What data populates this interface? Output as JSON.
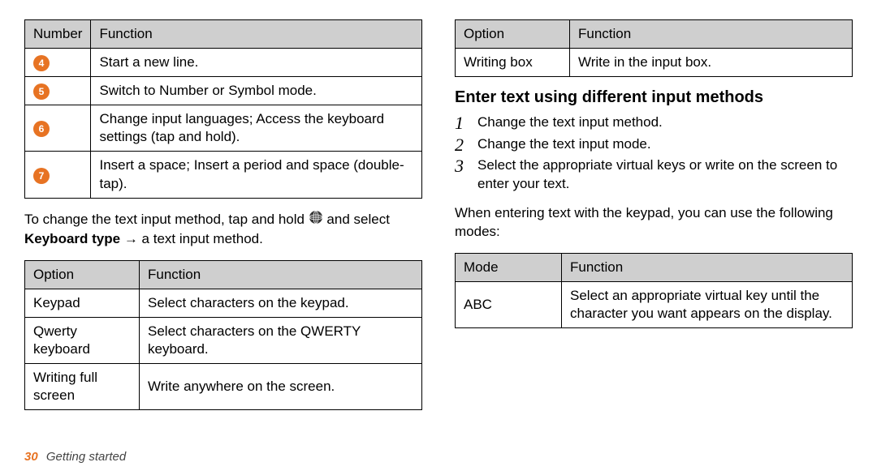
{
  "table1": {
    "headers": [
      "Number",
      "Function"
    ],
    "rows": [
      {
        "n": "4",
        "fn": "Start a new line."
      },
      {
        "n": "5",
        "fn": "Switch to Number or Symbol mode."
      },
      {
        "n": "6",
        "fn": "Change input languages; Access the keyboard settings (tap and hold)."
      },
      {
        "n": "7",
        "fn": "Insert a space; Insert a period and space (double-tap)."
      }
    ]
  },
  "para1_a": "To change the text input method, tap and hold ",
  "para1_b": " and select ",
  "para1_bold": "Keyboard type",
  "para1_c": " → a text input method.",
  "table2": {
    "headers": [
      "Option",
      "Function"
    ],
    "rows": [
      {
        "opt": "Keypad",
        "fn": "Select characters on the keypad."
      },
      {
        "opt": "Qwerty keyboard",
        "fn": "Select characters on the QWERTY keyboard."
      },
      {
        "opt": "Writing full screen",
        "fn": "Write anywhere on the screen."
      }
    ]
  },
  "table3": {
    "headers": [
      "Option",
      "Function"
    ],
    "rows": [
      {
        "opt": "Writing box",
        "fn": "Write in the input box."
      }
    ]
  },
  "heading": "Enter text using different input methods",
  "steps": [
    "Change the text input method.",
    "Change the text input mode.",
    "Select the appropriate virtual keys or write on the screen to enter your text."
  ],
  "para2": "When entering text with the keypad, you can use the following modes:",
  "table4": {
    "headers": [
      "Mode",
      "Function"
    ],
    "rows": [
      {
        "mode": "ABC",
        "fn": "Select an appropriate virtual key until the character you want appears on the display."
      }
    ]
  },
  "footer": {
    "page": "30",
    "section": "Getting started"
  }
}
